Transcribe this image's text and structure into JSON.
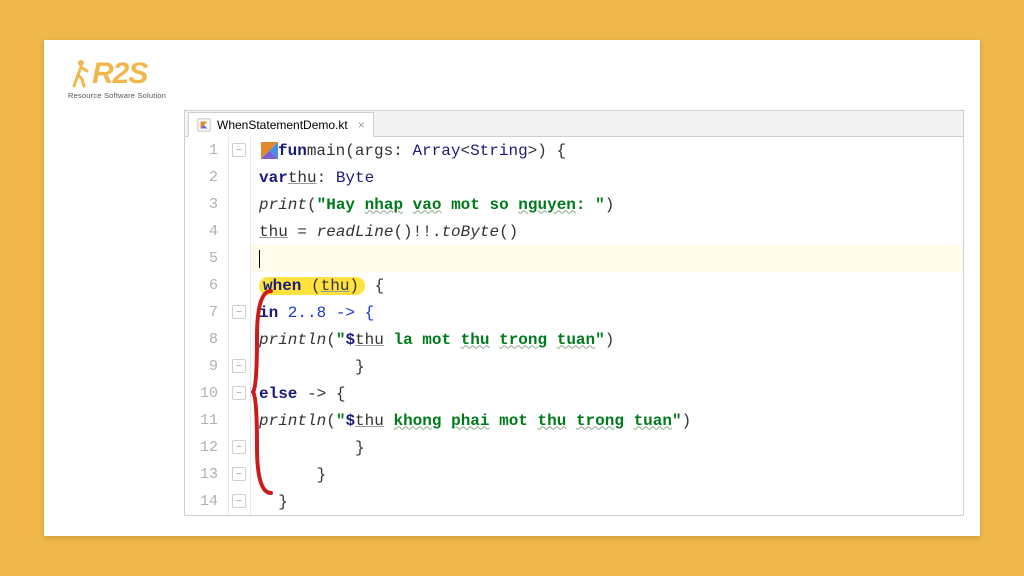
{
  "logo": {
    "text": "R2S",
    "tagline": "Resource Software Solution"
  },
  "tab": {
    "filename": "WhenStatementDemo.kt"
  },
  "gutter": {
    "start": 1,
    "end": 14
  },
  "code": {
    "l1": {
      "fun": "fun",
      "main": "main",
      "args": "args",
      "array": "Array",
      "string": "String"
    },
    "l2": {
      "var": "var",
      "thu": "thu",
      "byte": "Byte"
    },
    "l3": {
      "print": "print",
      "s1": "\"Hay ",
      "s2": "nhap",
      "s3": " ",
      "s4": "vao",
      "s5": " mot so ",
      "s6": "nguyen",
      "s7": ": \""
    },
    "l4": {
      "thu": "thu",
      "eq": " = ",
      "rl": "readLine",
      "bang": "()!!.",
      "tb": "toByte",
      "end": "()"
    },
    "l6": {
      "when": "when",
      "thu": "thu"
    },
    "l7": {
      "in": "in",
      "range": " 2..8 -> {"
    },
    "l8": {
      "pl": "println",
      "s1": "\"",
      "dollar": "$",
      "thu": "thu",
      "s2": " la mot ",
      "s3": "thu",
      "s4": " ",
      "s5": "trong",
      "s6": " ",
      "s7": "tuan",
      "s8": "\""
    },
    "l10": {
      "else": "else",
      "arrow": " -> {"
    },
    "l11": {
      "pl": "println",
      "s1": "\"",
      "dollar": "$",
      "thu": "thu",
      "s2": " ",
      "s3": "khong",
      "s4": " ",
      "s5": "phai",
      "s6": " mot ",
      "s7": "thu",
      "s8": " ",
      "s9": "trong",
      "s10": " ",
      "s11": "tuan",
      "s12": "\""
    }
  },
  "colors": {
    "frame": "#f0b84a",
    "highlight": "#ffe23d",
    "keyword": "#1a1a7a",
    "string": "#007a1c"
  }
}
